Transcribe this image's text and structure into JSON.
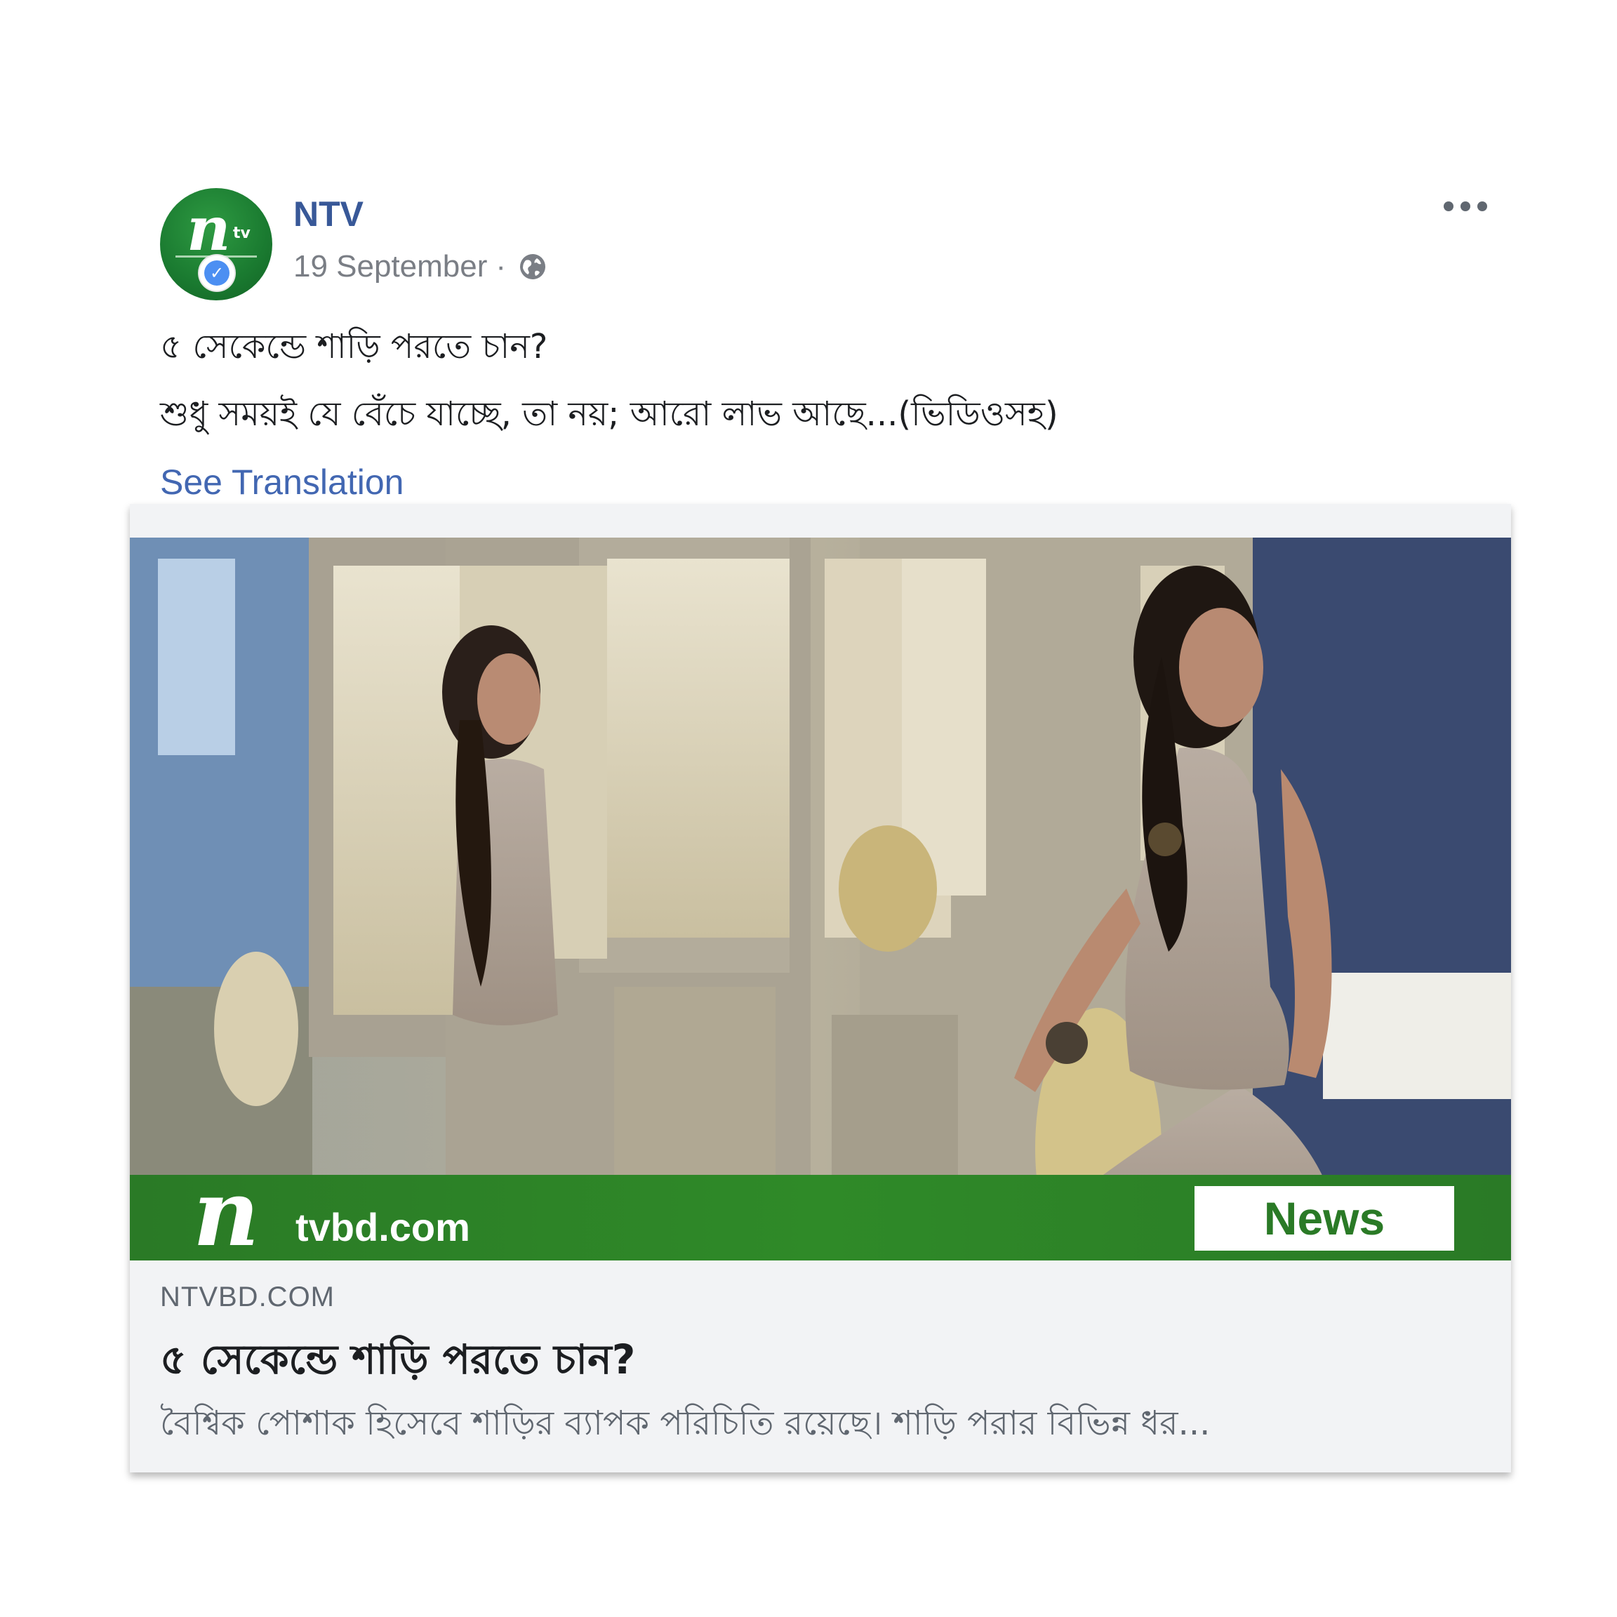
{
  "post": {
    "page_name": "NTV",
    "date": "19 September",
    "separator": "·",
    "audience_icon": "globe-icon",
    "avatar_logo": {
      "mark": "n",
      "suffix": "tv"
    },
    "verified_icon": "verified-badge-icon",
    "more_icon": "more-options-icon",
    "message_lines": [
      "৫ সেকেন্ডে শাড়ি পরতে চান?",
      "শুধু সময়ই যে বেঁচে যাচ্ছে, তা নয়; আরো লাভ আছে...(ভিডিওসহ)"
    ],
    "see_translation": "See Translation"
  },
  "link_card": {
    "image_banner": {
      "logo_mark": "n",
      "logo_domain": "tvbd.com",
      "badge": "News"
    },
    "domain": "NTVBD.COM",
    "title": "৫ সেকেন্ডে শাড়ি পরতে চান?",
    "description": "বৈশ্বিক পোশাক হিসেবে শাড়ির ব্যাপক পরিচিতি রয়েছে। শাড়ি পরার বিভিন্ন ধর..."
  },
  "colors": {
    "link_blue": "#385898",
    "translation_blue": "#4267b2",
    "brand_green": "#2a7a26",
    "meta_gray": "#7a7e85",
    "card_bg": "#f2f3f5"
  }
}
